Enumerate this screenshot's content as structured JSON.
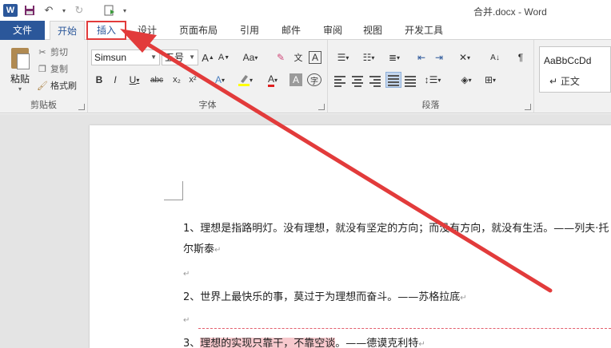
{
  "window": {
    "app_icon": "W",
    "title": "合并.docx - Word"
  },
  "quick_access": {
    "icons": [
      "word-icon",
      "save-icon",
      "undo-icon",
      "redo-icon",
      "customize-icon"
    ]
  },
  "tabs": [
    {
      "label": "文件"
    },
    {
      "label": "开始"
    },
    {
      "label": "插入"
    },
    {
      "label": "设计"
    },
    {
      "label": "页面布局"
    },
    {
      "label": "引用"
    },
    {
      "label": "邮件"
    },
    {
      "label": "审阅"
    },
    {
      "label": "视图"
    },
    {
      "label": "开发工具"
    }
  ],
  "clipboard": {
    "paste": "粘贴",
    "cut": "剪切",
    "copy": "复制",
    "format_painter": "格式刷",
    "group_label": "剪贴板"
  },
  "font": {
    "name": "Simsun",
    "size": "五号",
    "grow": "A",
    "shrink": "A",
    "case": "Aa",
    "phonetic": "文",
    "border": "A",
    "bold": "B",
    "italic": "I",
    "underline": "U",
    "strike": "abc",
    "subscript": "x₂",
    "superscript": "x²",
    "font_color": "A",
    "char_shading": "A",
    "enclose": "字",
    "group_label": "字体"
  },
  "paragraph": {
    "group_label": "段落"
  },
  "styles": {
    "sample": "AaBbCcDd",
    "name": "↵ 正文"
  },
  "colors": {
    "accent": "#2b579a",
    "annotation": "#e23b3b",
    "highlight": "#f7c9cd"
  },
  "document": {
    "lines": [
      "1、理想是指路明灯。没有理想，就没有坚定的方向；而没有方向，就没有生活。——列夫·托",
      "尔斯泰",
      "",
      "2、世界上最快乐的事，莫过于为理想而奋斗。——苏格拉底",
      "",
      "3、"
    ],
    "line3_highlight": "理想的实现只靠干，不靠空谈",
    "line3_rest": "。——德谟克利特",
    "para_mark": "↵"
  }
}
